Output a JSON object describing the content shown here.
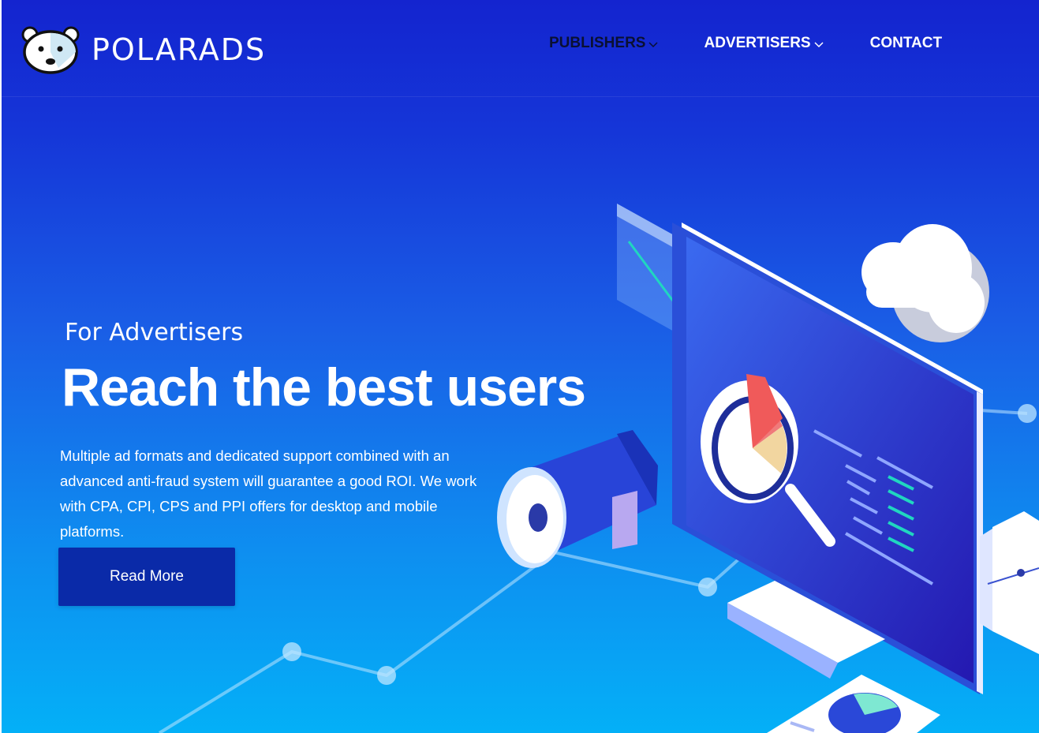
{
  "header": {
    "brand": "POLARADS",
    "logo_icon": "polar-bear-icon",
    "nav": [
      {
        "label": "PUBLISHERS",
        "has_dropdown": true,
        "active": true
      },
      {
        "label": "ADVERTISERS",
        "has_dropdown": true,
        "active": false
      },
      {
        "label": "CONTACT",
        "has_dropdown": false,
        "active": false
      }
    ]
  },
  "hero": {
    "eyebrow": "For Advertisers",
    "headline": "Reach the best users",
    "body": "Multiple ad formats and dedicated support combined with an advanced anti-fraud system will guarantee a good ROI. We work with CPA, CPI, CPS and PPI offers for desktop and mobile platforms.",
    "cta_label": "Read More"
  },
  "colors": {
    "bg_top": "#1424cf",
    "bg_bottom": "#04b0f7",
    "cta_bg": "#0a2aa8",
    "nav_active": "#0a1033"
  }
}
